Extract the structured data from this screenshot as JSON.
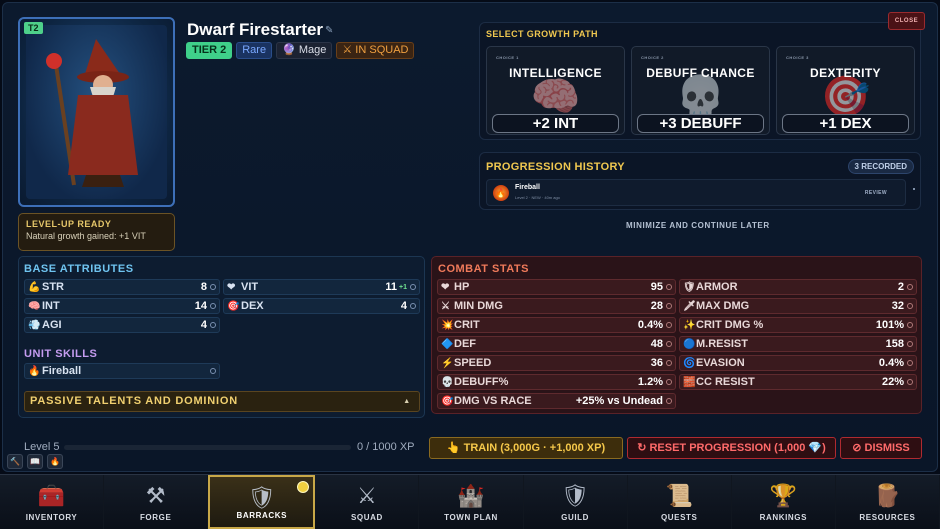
{
  "hero": {
    "tier_corner": "T2",
    "name": "Dwarf Firestarter",
    "tags": {
      "tier": "TIER 2",
      "rarity": "Rare",
      "class": "Mage",
      "squad": "IN SQUAD"
    }
  },
  "levelup": {
    "title": "LEVEL-UP READY",
    "subtitle": "Natural growth gained: +1 VIT"
  },
  "growth": {
    "title": "SELECT GROWTH PATH",
    "close_label": "CLOSE",
    "choices": [
      {
        "tiny": "CHOICE 1",
        "name": "INTELLIGENCE",
        "value": "+2 INT",
        "icon": "brain-icon"
      },
      {
        "tiny": "CHOICE 2",
        "name": "DEBUFF CHANCE",
        "value": "+3 DEBUFF",
        "icon": "skull-icon"
      },
      {
        "tiny": "CHOICE 3",
        "name": "DEXTERITY",
        "value": "+1 DEX",
        "icon": "target-icon"
      }
    ]
  },
  "history": {
    "title": "PROGRESSION HISTORY",
    "count": "3 RECORDED",
    "entries": [
      {
        "name": "Fireball",
        "detail": "Level 2 · NEW · 40m ago",
        "action": "REVIEW"
      }
    ]
  },
  "minimize_label": "MINIMIZE AND CONTINUE LATER",
  "base": {
    "title": "BASE ATTRIBUTES",
    "stats": [
      {
        "label": "STR",
        "value": "8",
        "icon": "muscle-icon"
      },
      {
        "label": "VIT",
        "value": "11",
        "bonus": "+1",
        "icon": "heart-icon"
      },
      {
        "label": "INT",
        "value": "14",
        "icon": "brain-icon"
      },
      {
        "label": "DEX",
        "value": "4",
        "icon": "target-icon"
      },
      {
        "label": "AGI",
        "value": "4",
        "icon": "wind-icon"
      }
    ],
    "skills_title": "UNIT SKILLS",
    "skills": [
      {
        "label": "Fireball",
        "icon": "fire-icon"
      }
    ],
    "passive": "PASSIVE TALENTS AND DOMINION"
  },
  "combat": {
    "title": "COMBAT STATS",
    "stats": [
      {
        "label": "HP",
        "value": "95"
      },
      {
        "label": "ARMOR",
        "value": "2"
      },
      {
        "label": "MIN DMG",
        "value": "28"
      },
      {
        "label": "MAX DMG",
        "value": "32"
      },
      {
        "label": "CRIT",
        "value": "0.4%"
      },
      {
        "label": "CRIT DMG %",
        "value": "101%"
      },
      {
        "label": "DEF",
        "value": "48"
      },
      {
        "label": "M.RESIST",
        "value": "158"
      },
      {
        "label": "SPEED",
        "value": "36"
      },
      {
        "label": "EVASION",
        "value": "0.4%"
      },
      {
        "label": "DEBUFF%",
        "value": "1.2%"
      },
      {
        "label": "CC RESIST",
        "value": "22%"
      },
      {
        "label": "DMG VS RACE",
        "value": "+25% vs Undead"
      }
    ]
  },
  "footer": {
    "level": "Level 5",
    "xp": "0 / 1000 XP",
    "xp_fraction": 0,
    "train": "TRAIN (3,000G · +1,000 XP)",
    "reset": "RESET PROGRESSION (1,000",
    "reset_tail": ")",
    "dismiss": "DISMISS"
  },
  "nav": [
    {
      "label": "INVENTORY",
      "icon": "chest-icon"
    },
    {
      "label": "FORGE",
      "icon": "anvil-icon"
    },
    {
      "label": "BARRACKS",
      "icon": "shield-icon",
      "active": true
    },
    {
      "label": "SQUAD",
      "icon": "squad-icon"
    },
    {
      "label": "TOWN PLAN",
      "icon": "castle-icon"
    },
    {
      "label": "GUILD",
      "icon": "guild-icon"
    },
    {
      "label": "QUESTS",
      "icon": "scroll-icon"
    },
    {
      "label": "RANKINGS",
      "icon": "trophy-icon"
    },
    {
      "label": "RESOURCES",
      "icon": "resources-icon"
    }
  ]
}
